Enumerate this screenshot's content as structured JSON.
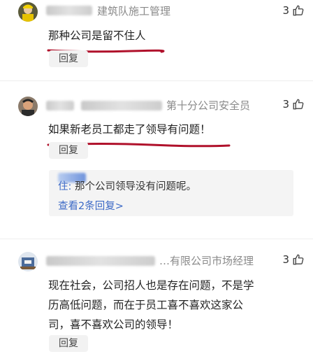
{
  "comments": [
    {
      "author_role": "建筑队施工管理",
      "likes": "3",
      "text": "那种公司是留不住人",
      "reply_label": "回复"
    },
    {
      "author_role": "第十分公司安全员",
      "likes": "3",
      "text": "如果新老员工都走了领导有问题！",
      "reply_label": "回复",
      "sub_reply": {
        "author_suffix": "住:",
        "text": "那个公司领导没有问题呢。",
        "view_more": "查看2条回复>"
      }
    },
    {
      "author_role": "…有限公司市场经理",
      "likes": "3",
      "text_lines": [
        "现在社会，公司招人也是存在问题，不是学",
        "历高低问题，而在于员工喜不喜欢这家公",
        "司，喜不喜欢公司的领导！"
      ],
      "reply_label": "回复"
    }
  ],
  "colors": {
    "underline": "#b0112b",
    "link": "#3b69c6"
  },
  "icons": {
    "like": "thumbs-up-icon"
  }
}
